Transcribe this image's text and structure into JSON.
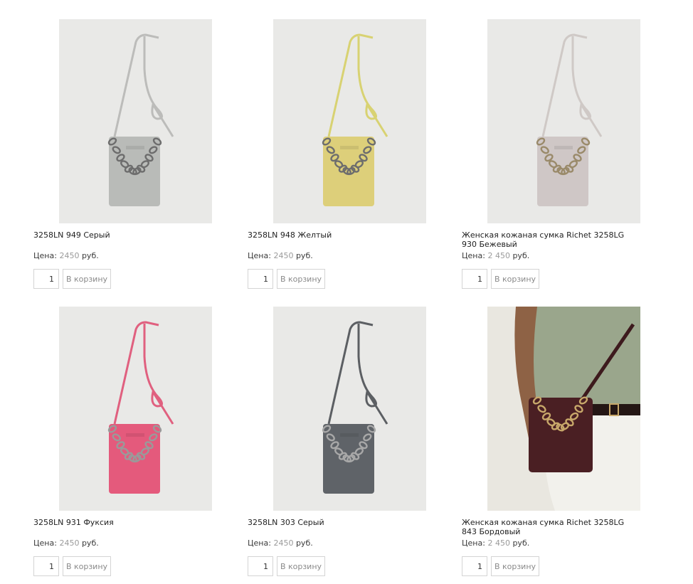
{
  "price_label": "Цена:",
  "cart_button_label": "В корзину",
  "products": [
    {
      "title": "3258LN 949 Серый",
      "price": "2450",
      "currency": "руб.",
      "qty": "1",
      "bag_color": "#b9bbb8",
      "strap_color": "#bcbcba",
      "bg_color": "#e9e9e7",
      "chain_color": "#6d6d6d"
    },
    {
      "title": "3258LN 948 Желтый",
      "price": "2450",
      "currency": "руб.",
      "qty": "1",
      "bag_color": "#ddcf7a",
      "strap_color": "#d8d272",
      "bg_color": "#e9e9e7",
      "chain_color": "#6d6d6d"
    },
    {
      "title": "Женская кожаная сумка Richet 3258LG 930 Бежевый",
      "price": "2 450",
      "currency": "руб.",
      "qty": "1",
      "bag_color": "#cfc7c6",
      "strap_color": "#cfc9c6",
      "bg_color": "#e9e9e7",
      "chain_color": "#9a8a6a"
    },
    {
      "title": "3258LN 931 Фуксия",
      "price": "2450",
      "currency": "руб.",
      "qty": "1",
      "bag_color": "#e45a7c",
      "strap_color": "#e0607f",
      "bg_color": "#e9e9e7",
      "chain_color": "#9a9a9a"
    },
    {
      "title": "3258LN 303 Серый",
      "price": "2450",
      "currency": "руб.",
      "qty": "1",
      "bag_color": "#5f6368",
      "strap_color": "#5c5f63",
      "bg_color": "#e9e9e7",
      "chain_color": "#a8a8a8"
    },
    {
      "title": "Женская кожаная сумка Richet 3258LG 843 Бордовый",
      "price": "2 450",
      "currency": "руб.",
      "qty": "1",
      "bag_color": "#4a1f23",
      "strap_color": "#3d1a1d",
      "bg_color": "#ecebe6",
      "chain_color": "#c8a86a",
      "model_photo": true
    }
  ]
}
